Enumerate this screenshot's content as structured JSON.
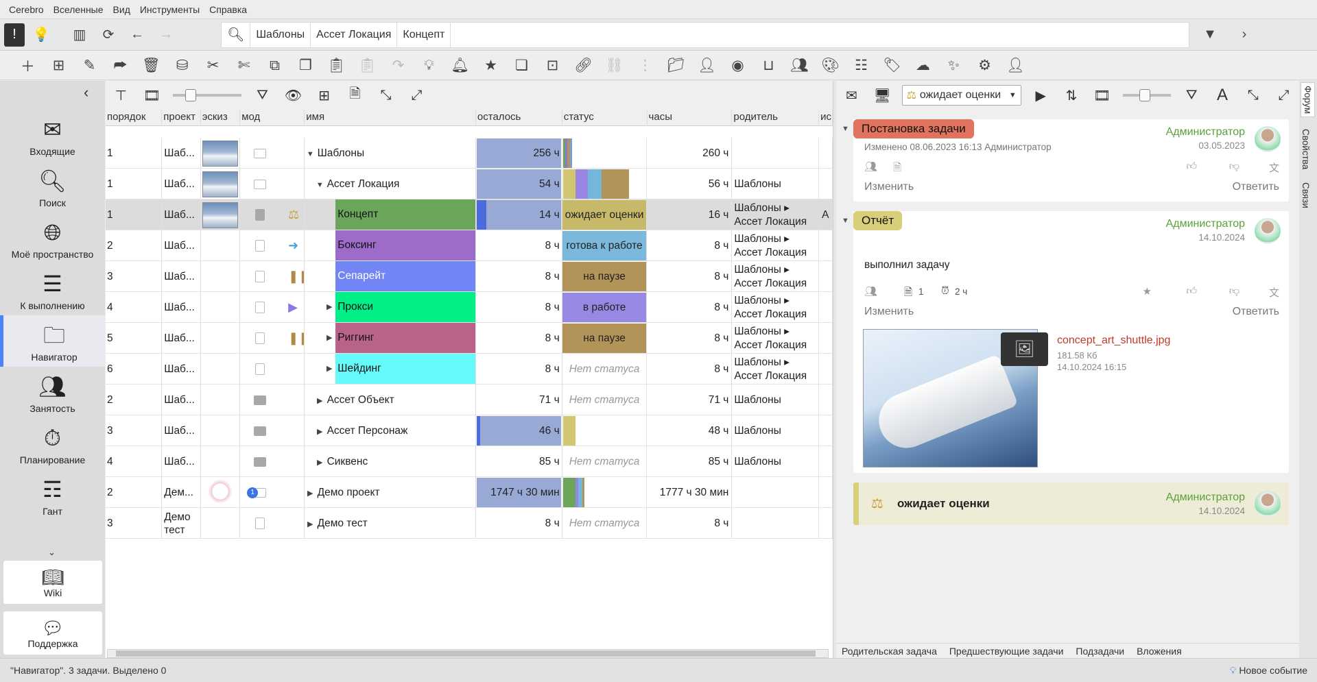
{
  "menu": [
    "Cerebro",
    "Вселенные",
    "Вид",
    "Инструменты",
    "Справка"
  ],
  "breadcrumbs": [
    "Шаблоны",
    "Ассет Локация",
    "Концепт"
  ],
  "sidebar": {
    "items": [
      {
        "label": "Входящие",
        "icon": "mail-icon"
      },
      {
        "label": "Поиск",
        "icon": "search-icon"
      },
      {
        "label": "Моё пространство",
        "icon": "globe-icon"
      },
      {
        "label": "К выполнению",
        "icon": "list-icon"
      },
      {
        "label": "Навигатор",
        "icon": "folder-icon"
      },
      {
        "label": "Занятость",
        "icon": "people-icon"
      },
      {
        "label": "Планирование",
        "icon": "clock-plus-icon"
      },
      {
        "label": "Гант",
        "icon": "gantt-icon"
      }
    ],
    "wiki": "Wiki",
    "support": "Поддержка"
  },
  "columns": [
    "порядок",
    "проект",
    "эскиз",
    "мод",
    "имя",
    "осталось",
    "статус",
    "часы",
    "родитель",
    "ис"
  ],
  "rows": [
    {
      "ord": "1",
      "proj": "Шаб...",
      "name": "Шаблоны",
      "rem": "256 ч",
      "status": "",
      "hours": "260 ч",
      "parent": ""
    },
    {
      "ord": "1",
      "proj": "Шаб...",
      "name": "Ассет Локация",
      "rem": "54 ч",
      "status": "",
      "hours": "56 ч",
      "parent": "Шаблоны"
    },
    {
      "ord": "1",
      "proj": "Шаб...",
      "name": "Концепт",
      "rem": "14 ч",
      "status": "ожидает оценки",
      "hours": "16 ч",
      "parent": "Шаблоны ▸ Ассет Локация",
      "last": "А"
    },
    {
      "ord": "2",
      "proj": "Шаб...",
      "name": "Боксинг",
      "rem": "8 ч",
      "status": "готова к работе",
      "hours": "8 ч",
      "parent": "Шаблоны ▸ Ассет Локация"
    },
    {
      "ord": "3",
      "proj": "Шаб...",
      "name": "Сепарейт",
      "rem": "8 ч",
      "status": "на паузе",
      "hours": "8 ч",
      "parent": "Шаблоны ▸ Ассет Локация"
    },
    {
      "ord": "4",
      "proj": "Шаб...",
      "name": "Прокси",
      "rem": "8 ч",
      "status": "в работе",
      "hours": "8 ч",
      "parent": "Шаблоны ▸ Ассет Локация"
    },
    {
      "ord": "5",
      "proj": "Шаб...",
      "name": "Риггинг",
      "rem": "8 ч",
      "status": "на паузе",
      "hours": "8 ч",
      "parent": "Шаблоны ▸ Ассет Локация"
    },
    {
      "ord": "6",
      "proj": "Шаб...",
      "name": "Шейдинг",
      "rem": "8 ч",
      "status": "Нет статуса",
      "hours": "8 ч",
      "parent": "Шаблоны ▸ Ассет Локация"
    },
    {
      "ord": "2",
      "proj": "Шаб...",
      "name": "Ассет Объект",
      "rem": "71 ч",
      "status": "Нет статуса",
      "hours": "71 ч",
      "parent": "Шаблоны"
    },
    {
      "ord": "3",
      "proj": "Шаб...",
      "name": "Ассет Персонаж",
      "rem": "46 ч",
      "status": "",
      "hours": "48 ч",
      "parent": "Шаблоны"
    },
    {
      "ord": "4",
      "proj": "Шаб...",
      "name": "Сиквенс",
      "rem": "85 ч",
      "status": "Нет статуса",
      "hours": "85 ч",
      "parent": "Шаблоны"
    },
    {
      "ord": "2",
      "proj": "Дем...",
      "name": "Демо проект",
      "rem": "1747 ч 30 мин",
      "status": "",
      "hours": "1777 ч 30 мин",
      "parent": "",
      "badge": "1"
    },
    {
      "ord": "3",
      "proj": "Демо тест",
      "name": "Демо тест",
      "rem": "8 ч",
      "status": "Нет статуса",
      "hours": "8 ч",
      "parent": ""
    }
  ],
  "right": {
    "status_select": "ожидает оценки",
    "posts": [
      {
        "tag": "Постановка задачи",
        "author": "Администратор",
        "date": "03.05.2023",
        "meta": "Изменено 08.06.2023 16:13  Администратор",
        "edit": "Изменить",
        "reply": "Ответить"
      },
      {
        "tag": "Отчёт",
        "author": "Администратор",
        "date": "14.10.2024",
        "body": "выполнил задачу",
        "files": "1",
        "time": "2 ч",
        "edit": "Изменить",
        "reply": "Ответить",
        "attachment": {
          "name": "concept_art_shuttle.jpg",
          "size": "181.58 Кб",
          "date": "14.10.2024 16:15"
        }
      },
      {
        "tag": "ожидает оценки",
        "author": "Администратор",
        "date": "14.10.2024"
      }
    ],
    "footer_tabs": [
      "Родительская задача",
      "Предшествующие задачи",
      "Подзадачи",
      "Вложения"
    ],
    "vtabs": [
      "Форум",
      "Свойства",
      "Связи"
    ]
  },
  "statusbar": {
    "left": "\"Навигатор\". 3 задачи. Выделено 0",
    "right": "Новое событие"
  }
}
